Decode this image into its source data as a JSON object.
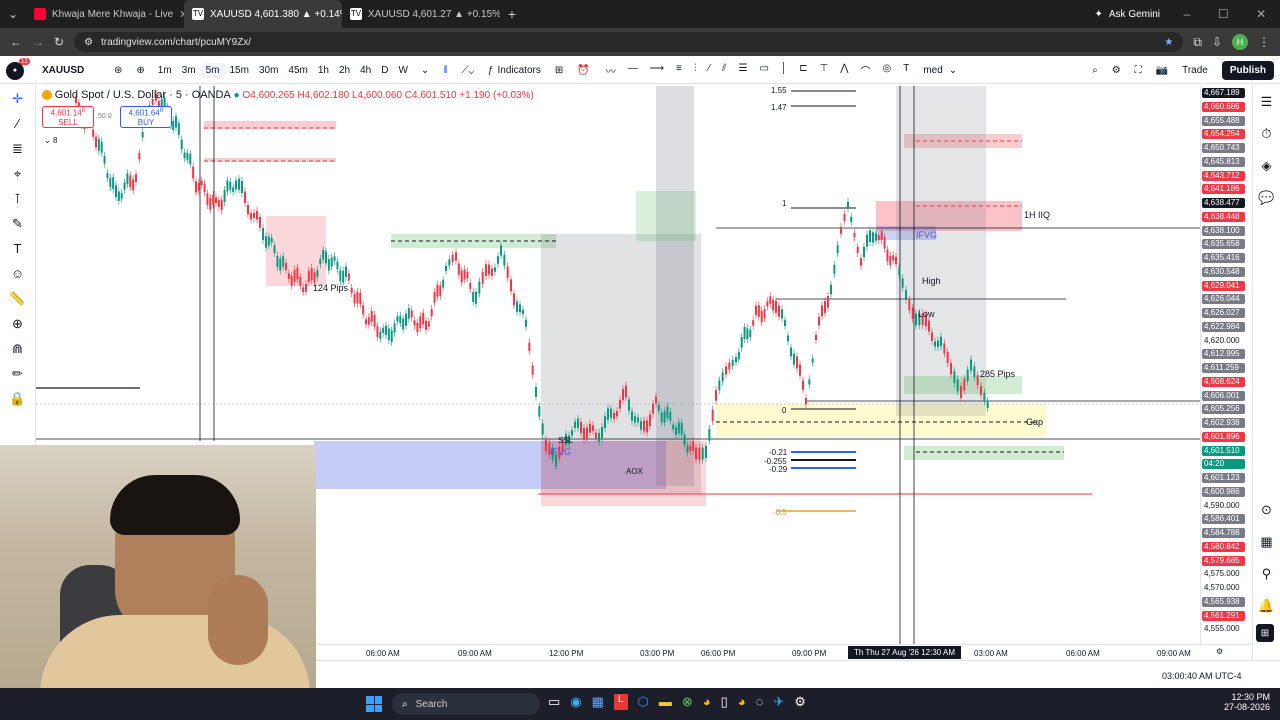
{
  "browser": {
    "tabs": [
      {
        "title": "Khwaja Mere Khwaja - Live",
        "active": false,
        "icon": "youtube-icon",
        "color": "#ff0033"
      },
      {
        "title": "XAUUSD 4,601.380 ▲ +0.14% U",
        "active": true,
        "icon": "tradingview-icon",
        "color": "#ffffff"
      },
      {
        "title": "XAUUSD 4,601.27 ▲ +0.15% U",
        "active": false,
        "icon": "tradingview-icon",
        "color": "#ffffff"
      }
    ],
    "ask_gemini": "Ask Gemini",
    "url": "tradingview.com/chart/pcuMY9Zx/",
    "profile_initial": "H"
  },
  "toolbar": {
    "symbol": "XAUUSD",
    "timeframes": [
      "1m",
      "3m",
      "5m",
      "15m",
      "30m",
      "45m",
      "1h",
      "2h",
      "4h",
      "D",
      "W"
    ],
    "selected_timeframe": "5m",
    "indicators_label": "Indicators",
    "unnamed_label": "med",
    "trade_label": "Trade",
    "publish_label": "Publish",
    "notification_count": "11"
  },
  "legend": {
    "title": "Gold Spot / U.S. Dollar · 5 · OANDA",
    "ohlc": "O4,600.265 H4,602.180 L4,600.060 C4,601.510 +1.190 (+0.03%)",
    "sell_price": "4,601.14",
    "sell_sup": "0",
    "sell_label": "SELL",
    "spread": "50.0",
    "buy_price": "4,601.64",
    "buy_sup": "0",
    "buy_label": "BUY",
    "indicator_count": "8"
  },
  "annotations": {
    "pips_1": "124 Pips",
    "pips_2": "285 Pips",
    "high": "High",
    "low": "Low",
    "ifvg_1": "IFVG",
    "ifvg_2": "IFVG",
    "ssl": "SSL",
    "aox": "AOX",
    "gap": "Gap",
    "liq_1h": "1H IIQ",
    "fib_1": "1",
    "fib_0": "0",
    "fib_m05": "-0.5",
    "fib_155": "1.55",
    "fib_147": "1.47",
    "fib_021": "-0.21",
    "fib_0255": "-0.255",
    "fib_029": "-0.29"
  },
  "price_axis": {
    "colors": {
      "red": "#f23645",
      "dark": "#131722",
      "gray": "#787b86",
      "blue": "#2962ff"
    },
    "labels": [
      {
        "v": "4,667.189",
        "t": "dark"
      },
      {
        "v": "4,660.686",
        "t": "red"
      },
      {
        "v": "4,655.488",
        "t": "gray"
      },
      {
        "v": "4,654.254",
        "t": "red"
      },
      {
        "v": "4,650.743",
        "t": "gray"
      },
      {
        "v": "4,645.813",
        "t": "gray"
      },
      {
        "v": "4,643.712",
        "t": "red"
      },
      {
        "v": "4,641.186",
        "t": "red"
      },
      {
        "v": "4,638.477",
        "t": "dark"
      },
      {
        "v": "4,638.448",
        "t": "red"
      },
      {
        "v": "4,638.100",
        "t": "gray"
      },
      {
        "v": "4,635.658",
        "t": "gray"
      },
      {
        "v": "4,635.416",
        "t": "gray"
      },
      {
        "v": "4,630.548",
        "t": "gray"
      },
      {
        "v": "4,629.041",
        "t": "red"
      },
      {
        "v": "4,626.044",
        "t": "gray"
      },
      {
        "v": "4,626.027",
        "t": "gray"
      },
      {
        "v": "4,622.984",
        "t": "gray"
      },
      {
        "v": "4,620.000",
        "t": "plain"
      },
      {
        "v": "4,612.995",
        "t": "gray"
      },
      {
        "v": "4,611.259",
        "t": "gray"
      },
      {
        "v": "4,608.624",
        "t": "red"
      },
      {
        "v": "4,606.001",
        "t": "gray"
      },
      {
        "v": "4,605.256",
        "t": "gray"
      },
      {
        "v": "4,602.938",
        "t": "gray"
      },
      {
        "v": "4,601.896",
        "t": "red"
      },
      {
        "v": "4,601.510",
        "t": "green"
      },
      {
        "v": "04:20",
        "t": "green"
      },
      {
        "v": "4,601.123",
        "t": "gray"
      },
      {
        "v": "4,600.986",
        "t": "gray"
      },
      {
        "v": "4,590.000",
        "t": "plain"
      },
      {
        "v": "4,586.401",
        "t": "gray"
      },
      {
        "v": "4,584.788",
        "t": "gray"
      },
      {
        "v": "4,580.842",
        "t": "red"
      },
      {
        "v": "4,579.685",
        "t": "red"
      },
      {
        "v": "4,575.000",
        "t": "plain"
      },
      {
        "v": "4,570.000",
        "t": "plain"
      },
      {
        "v": "4,565.938",
        "t": "gray"
      },
      {
        "v": "4,561.291",
        "t": "red"
      },
      {
        "v": "4,555.000",
        "t": "plain"
      }
    ]
  },
  "time_axis": {
    "labels": [
      "06:00 AM",
      "09:00 AM",
      "12:00 PM",
      "03:00 PM",
      "06:00 PM",
      "09:00 PM",
      "03:00 AM",
      "06:00 AM",
      "09:00 AM"
    ],
    "crosshair_label": "Th  Thu 27 Aug '26  12:30 AM"
  },
  "status": {
    "clock": "03:00:40 AM UTC-4"
  },
  "taskbar": {
    "search_placeholder": "Search",
    "time": "12:30 PM",
    "date": "27-08-2026"
  }
}
